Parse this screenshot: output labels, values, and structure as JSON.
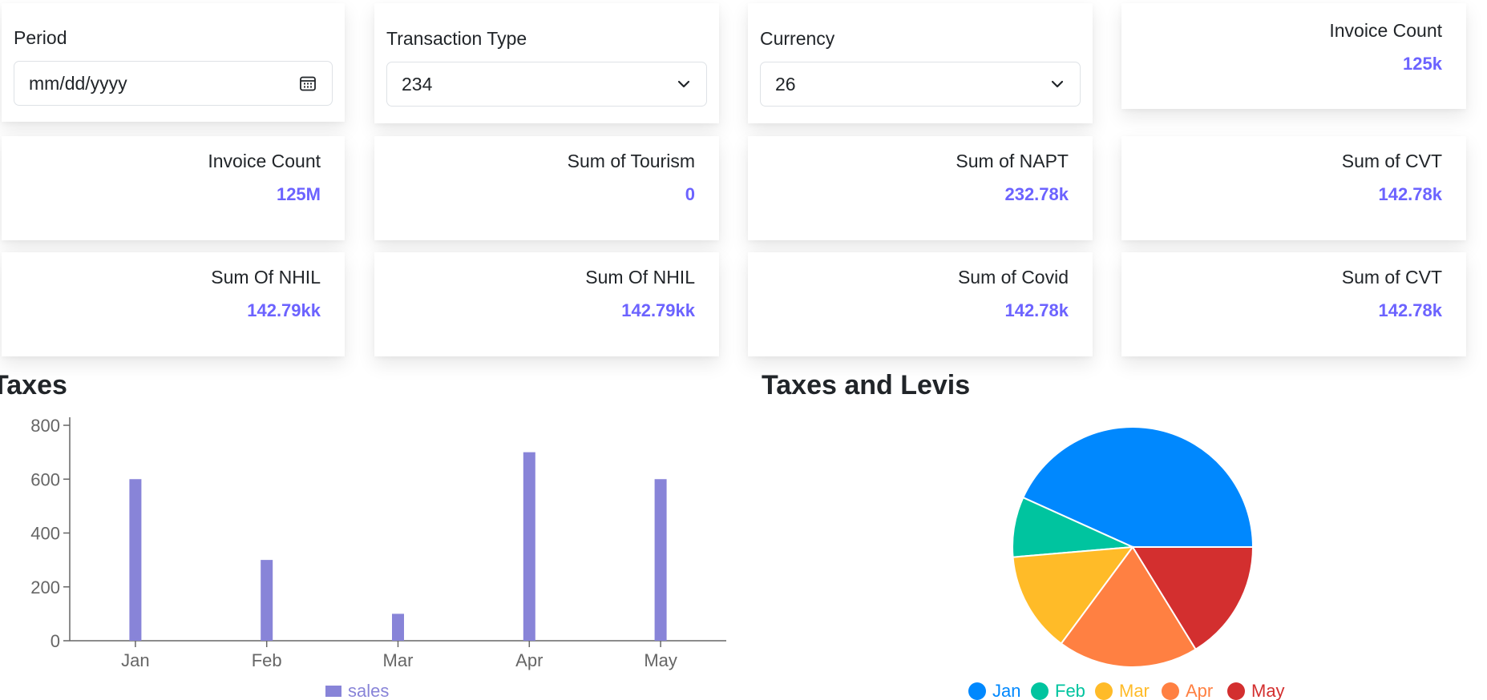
{
  "filters": {
    "period": {
      "label": "Period",
      "placeholder": "mm/dd/yyyy"
    },
    "transaction_type": {
      "label": "Transaction Type",
      "value": "234"
    },
    "currency": {
      "label": "Currency",
      "value": "26"
    }
  },
  "stats": [
    {
      "label": "Invoice Count",
      "value": "125k"
    },
    {
      "label": "Invoice Count",
      "value": "125M"
    },
    {
      "label": "Sum of Tourism",
      "value": "0"
    },
    {
      "label": "Sum of NAPT",
      "value": "232.78k"
    },
    {
      "label": "Sum of CVT",
      "value": "142.78k"
    },
    {
      "label": "Sum Of NHIL",
      "value": "142.79kk"
    },
    {
      "label": "Sum Of NHIL",
      "value": "142.79kk"
    },
    {
      "label": "Sum of Covid",
      "value": "142.78k"
    },
    {
      "label": "Sum of CVT",
      "value": "142.78k"
    }
  ],
  "colors": {
    "accent": "#6c63ff",
    "bar": "#8884d8"
  },
  "chart_data": [
    {
      "type": "bar",
      "title": "Taxes",
      "categories": [
        "Jan",
        "Feb",
        "Mar",
        "Apr",
        "May"
      ],
      "series": [
        {
          "name": "sales",
          "values": [
            600,
            300,
            100,
            700,
            600
          ],
          "color": "#8884d8"
        }
      ],
      "ylim": [
        0,
        800
      ],
      "yticks": [
        0,
        200,
        400,
        600,
        800
      ],
      "xlabel": "",
      "ylabel": "",
      "grid": false,
      "legend": "bottom"
    },
    {
      "type": "pie",
      "title": "Taxes and Levis",
      "categories": [
        "Jan",
        "Feb",
        "Mar",
        "Apr",
        "May"
      ],
      "values": [
        400,
        75,
        125,
        175,
        150
      ],
      "colors": [
        "#0088fe",
        "#00c49f",
        "#ffbb28",
        "#ff8042",
        "#d32f2f"
      ],
      "legend": "bottom"
    }
  ]
}
